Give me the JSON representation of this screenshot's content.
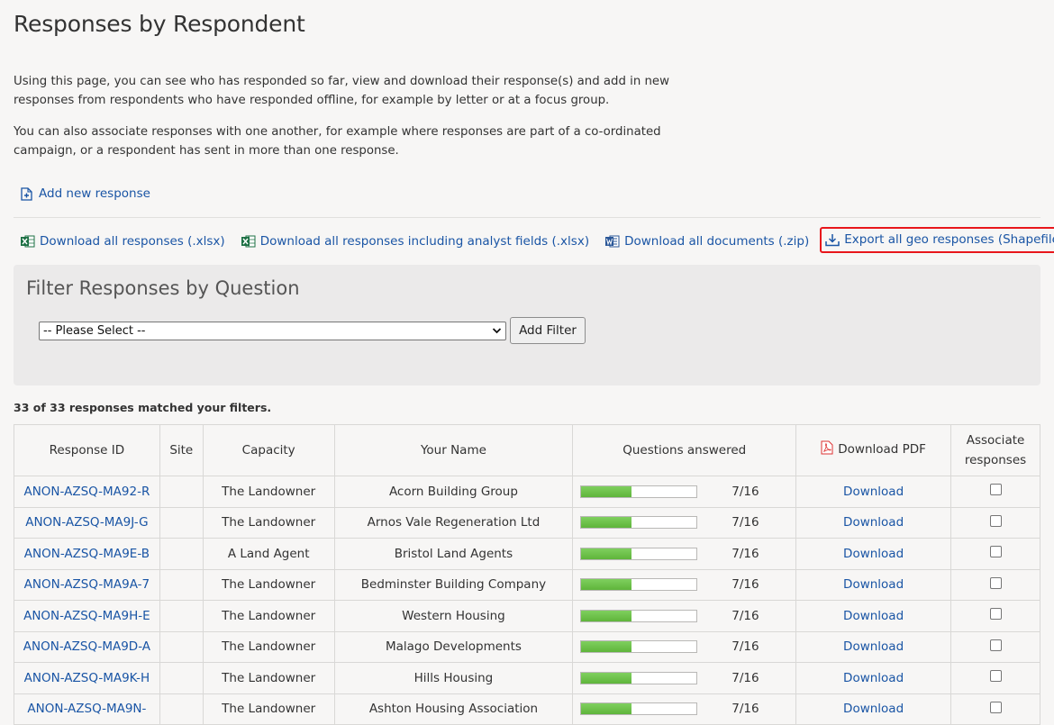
{
  "page": {
    "title": "Responses by Respondent",
    "intro_1": "Using this page, you can see who has responded so far, view and download their response(s) and add in new responses from respondents who have responded offline, for example by letter or at a focus group.",
    "intro_2": "You can also associate responses with one another, for example where responses are part of a co-ordinated campaign, or a respondent has sent in more than one response."
  },
  "actions": {
    "add_new": "Add new response",
    "dl_xlsx": "Download all responses (.xlsx)",
    "dl_xlsx_analyst": "Download all responses including analyst fields (.xlsx)",
    "dl_docs": "Download all documents (.zip)",
    "export_geo": "Export all geo responses (Shapefile)"
  },
  "filter": {
    "heading": "Filter Responses by Question",
    "select_value": "-- Please Select --",
    "add_button": "Add Filter"
  },
  "results": {
    "matched": "33 of 33 responses matched your filters."
  },
  "table": {
    "headers": {
      "id": "Response ID",
      "site": "Site",
      "capacity": "Capacity",
      "name": "Your Name",
      "questions": "Questions answered",
      "pdf": "Download PDF",
      "associate_1": "Associate",
      "associate_2": "responses"
    },
    "rows": [
      {
        "id": "ANON-AZSQ-MA92-R",
        "capacity": "The Landowner",
        "name": "Acorn Building Group",
        "answered": "7/16",
        "fraction": 0.4375,
        "download": "Download"
      },
      {
        "id": "ANON-AZSQ-MA9J-G",
        "capacity": "The Landowner",
        "name": "Arnos Vale Regeneration Ltd",
        "answered": "7/16",
        "fraction": 0.4375,
        "download": "Download"
      },
      {
        "id": "ANON-AZSQ-MA9E-B",
        "capacity": "A Land Agent",
        "name": "Bristol Land Agents",
        "answered": "7/16",
        "fraction": 0.4375,
        "download": "Download"
      },
      {
        "id": "ANON-AZSQ-MA9A-7",
        "capacity": "The Landowner",
        "name": "Bedminster Building Company",
        "answered": "7/16",
        "fraction": 0.4375,
        "download": "Download"
      },
      {
        "id": "ANON-AZSQ-MA9H-E",
        "capacity": "The Landowner",
        "name": "Western Housing",
        "answered": "7/16",
        "fraction": 0.4375,
        "download": "Download"
      },
      {
        "id": "ANON-AZSQ-MA9D-A",
        "capacity": "The Landowner",
        "name": "Malago Developments",
        "answered": "7/16",
        "fraction": 0.4375,
        "download": "Download"
      },
      {
        "id": "ANON-AZSQ-MA9K-H",
        "capacity": "The Landowner",
        "name": "Hills Housing",
        "answered": "7/16",
        "fraction": 0.4375,
        "download": "Download"
      },
      {
        "id": "ANON-AZSQ-MA9N-",
        "capacity": "The Landowner",
        "name": "Ashton Housing Association",
        "answered": "7/16",
        "fraction": 0.4375,
        "download": "Download"
      }
    ]
  },
  "colors": {
    "link": "#1a55a5",
    "progress": "#6cc04a",
    "highlight_border": "#e8161b"
  }
}
